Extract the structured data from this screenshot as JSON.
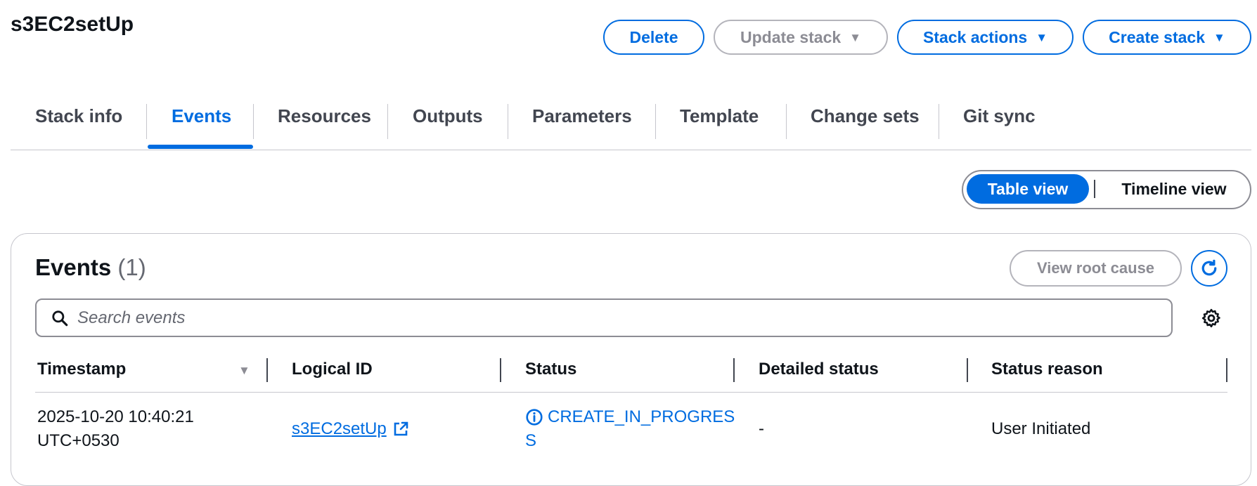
{
  "header": {
    "title": "s3EC2setUp",
    "buttons": {
      "delete": "Delete",
      "update_stack": "Update stack",
      "stack_actions": "Stack actions",
      "create_stack": "Create stack"
    }
  },
  "tabs": [
    {
      "label": "Stack info"
    },
    {
      "label": "Events"
    },
    {
      "label": "Resources"
    },
    {
      "label": "Outputs"
    },
    {
      "label": "Parameters"
    },
    {
      "label": "Template"
    },
    {
      "label": "Change sets"
    },
    {
      "label": "Git sync"
    }
  ],
  "active_tab": "Events",
  "view_toggle": {
    "table": "Table view",
    "timeline": "Timeline view",
    "selected": "Table view"
  },
  "events": {
    "heading": "Events",
    "count": "(1)",
    "view_root_cause": "View root cause",
    "search_placeholder": "Search events",
    "columns": [
      "Timestamp",
      "Logical ID",
      "Status",
      "Detailed status",
      "Status reason"
    ],
    "rows": [
      {
        "timestamp_line1": "2025-10-20 10:40:21",
        "timestamp_line2": "UTC+0530",
        "logical_id": "s3EC2setUp",
        "status_line1": "CREATE_IN_PROGRES",
        "status_line2": "S",
        "detailed_status": "-",
        "status_reason": "User Initiated"
      }
    ]
  },
  "icons": {
    "caret": "caret-down-icon",
    "sort": "sort-desc-icon",
    "search": "search-icon",
    "refresh": "refresh-icon",
    "settings": "gear-icon",
    "external": "external-link-icon",
    "info": "info-icon"
  },
  "colors": {
    "accent": "#006ce0",
    "text": "#0f141a",
    "muted": "#656871",
    "border": "#c6c6cd"
  }
}
